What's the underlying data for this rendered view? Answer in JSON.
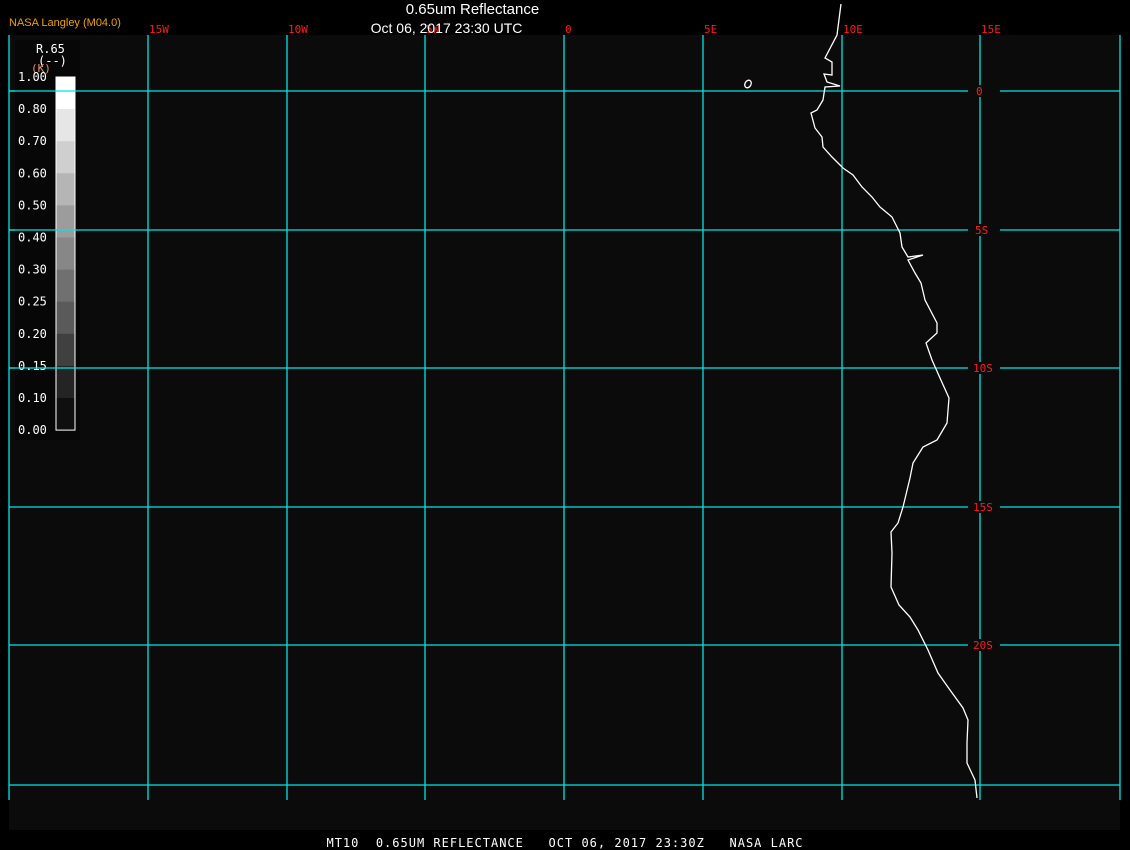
{
  "header": {
    "title": "0.65um Reflectance",
    "subtitle": "Oct 06, 2017 23:30 UTC",
    "agency": "NASA Langley (M04.0)"
  },
  "caption": "MT10  0.65UM REFLECTANCE   OCT 06, 2017 23:30Z   NASA LARC",
  "colors": {
    "grid": "#00e5e5",
    "labels": "#ff1a1a",
    "coastline": "#ffffff",
    "background": "#0b0b0b",
    "agency": "#f0a000"
  },
  "map": {
    "longitude_labels": [
      "15W",
      "10W",
      "5W",
      "0",
      "5E",
      "10E",
      "15E"
    ],
    "latitude_labels": [
      "0",
      "5S",
      "10S",
      "15S",
      "20S"
    ]
  },
  "legend": {
    "variable": "R.65",
    "units": "(--)",
    "units_alt": "(K)",
    "labels": [
      "1.00",
      "0.80",
      "0.70",
      "0.60",
      "0.50",
      "0.40",
      "0.30",
      "0.25",
      "0.20",
      "0.15",
      "0.10",
      "0.00"
    ],
    "colors": [
      "#ffffff",
      "#e6e6e6",
      "#cfcfcf",
      "#b5b5b5",
      "#9c9c9c",
      "#878787",
      "#707070",
      "#5a5a5a",
      "#404040",
      "#242424",
      "#0f0f0f"
    ]
  }
}
